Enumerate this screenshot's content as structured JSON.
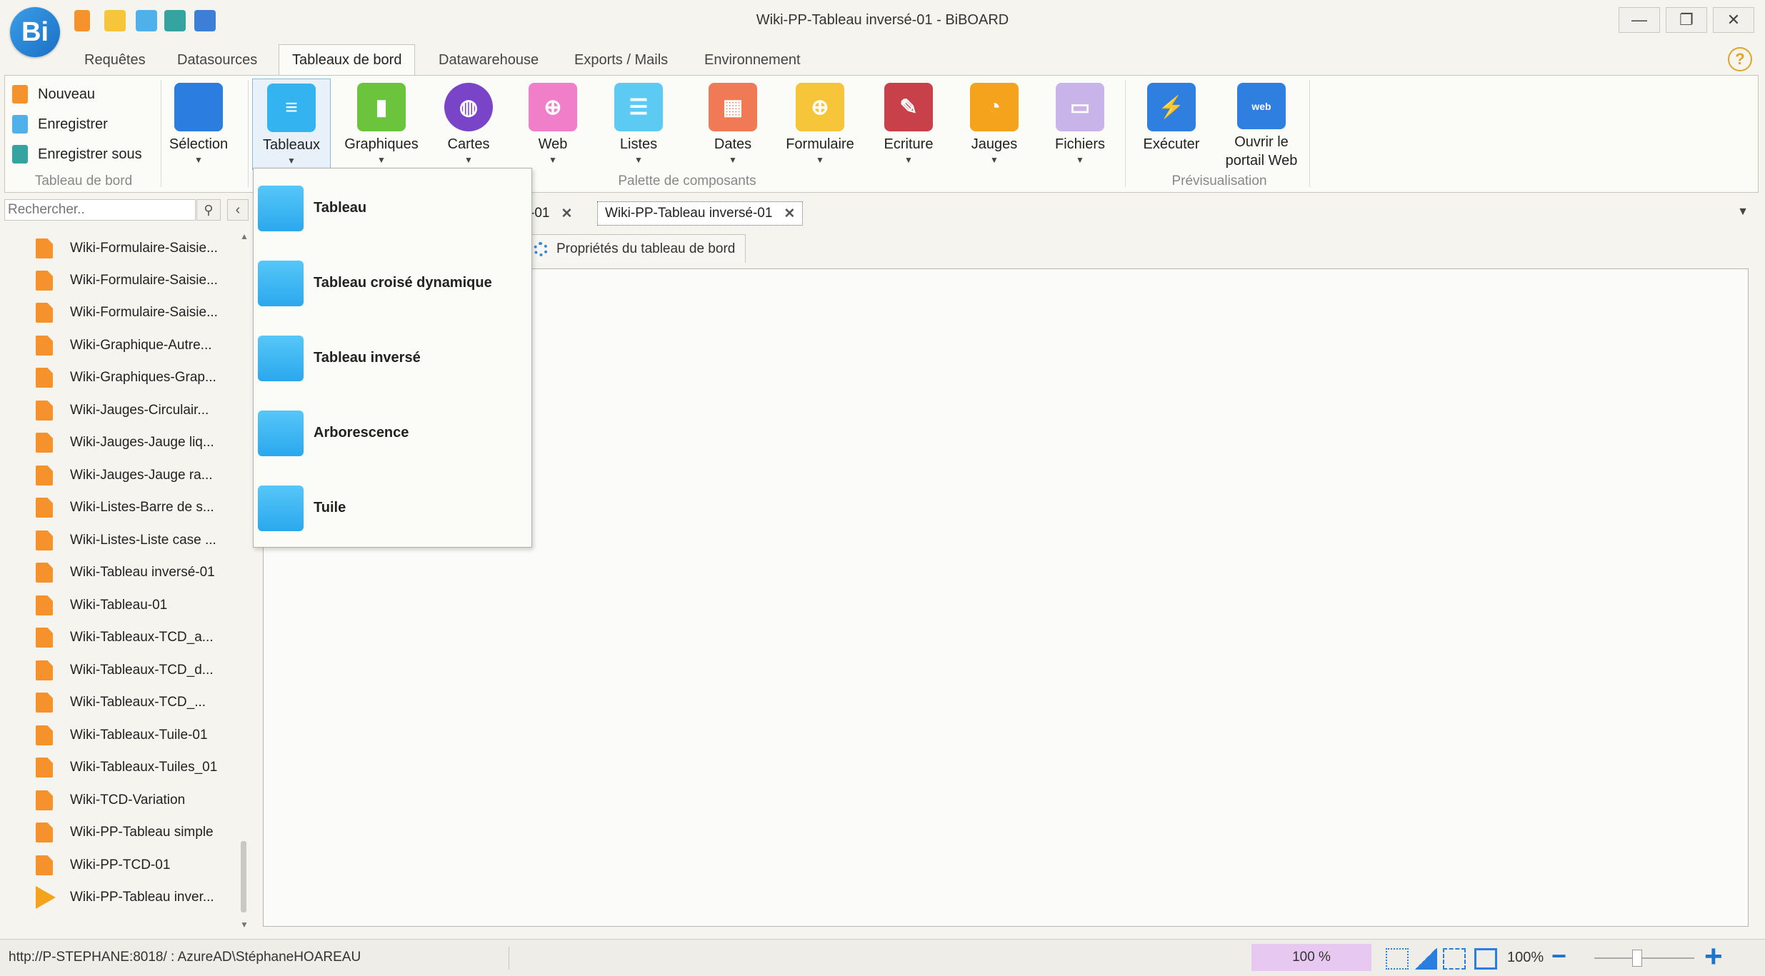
{
  "window": {
    "title": "Wiki-PP-Tableau inversé-01 - BiBOARD",
    "logo_text": "Bi",
    "minimize": "—",
    "maximize": "❐",
    "close": "✕"
  },
  "ribbon_tabs": [
    "Requêtes",
    "Datasources",
    "Tableaux de bord",
    "Datawarehouse",
    "Exports / Mails",
    "Environnement"
  ],
  "help_icon": "?",
  "tableau_de_bord_group": {
    "items": [
      "Nouveau",
      "Enregistrer",
      "Enregistrer sous"
    ],
    "label": "Tableau de bord"
  },
  "palette": {
    "label": "Palette de composants",
    "buttons": [
      {
        "label": "Sélection",
        "color": "#2b7de0"
      },
      {
        "label": "Tableaux",
        "color": "#33b3f0"
      },
      {
        "label": "Graphiques",
        "color": "#6cc43c"
      },
      {
        "label": "Cartes",
        "color": "#7a44c8"
      },
      {
        "label": "Web",
        "color": "#f07ec8"
      },
      {
        "label": "Listes",
        "color": "#5ccaf2"
      },
      {
        "label": "Dates",
        "color": "#f07a56"
      },
      {
        "label": "Formulaire",
        "color": "#f7c53a"
      },
      {
        "label": "Ecriture",
        "color": "#c8404a"
      },
      {
        "label": "Jauges",
        "color": "#f5a21c"
      },
      {
        "label": "Fichiers",
        "color": "#c9b4ea"
      }
    ]
  },
  "preview": {
    "label": "Prévisualisation",
    "buttons": [
      {
        "label": "Exécuter",
        "color": "#2f7fe0"
      },
      {
        "label": "Ouvrir le portail Web",
        "color": "#2f7fe0",
        "badge": "web"
      }
    ]
  },
  "dropdown": {
    "items": [
      "Tableau",
      "Tableau croisé dynamique",
      "Tableau inversé",
      "Arborescence",
      "Tuile"
    ]
  },
  "search": {
    "placeholder": "Rechercher.."
  },
  "tree_items": [
    "Wiki-Formulaire-Saisie...",
    "Wiki-Formulaire-Saisie...",
    "Wiki-Formulaire-Saisie...",
    "Wiki-Graphique-Autre...",
    "Wiki-Graphiques-Grap...",
    "Wiki-Jauges-Circulair...",
    "Wiki-Jauges-Jauge liq...",
    "Wiki-Jauges-Jauge ra...",
    "Wiki-Listes-Barre de s...",
    "Wiki-Listes-Liste case ...",
    "Wiki-Tableau inversé-01",
    "Wiki-Tableau-01",
    "Wiki-Tableaux-TCD_a...",
    "Wiki-Tableaux-TCD_d...",
    "Wiki-Tableaux-TCD_...",
    "Wiki-Tableaux-Tuile-01",
    "Wiki-Tableaux-Tuiles_01",
    "Wiki-TCD-Variation",
    "Wiki-PP-Tableau simple",
    "Wiki-PP-TCD-01",
    "Wiki-PP-Tableau inver..."
  ],
  "doc_tabs": {
    "prev_tab": "-01",
    "active_tab": "Wiki-PP-Tableau inversé-01",
    "close": "✕",
    "props_tab": "Propriétés du tableau de bord"
  },
  "status": {
    "connection": "http://P-STEPHANE:8018/ : AzureAD\\StéphaneHOAREAU",
    "zoom_box": "100 %",
    "zoom_pct": "100%"
  }
}
